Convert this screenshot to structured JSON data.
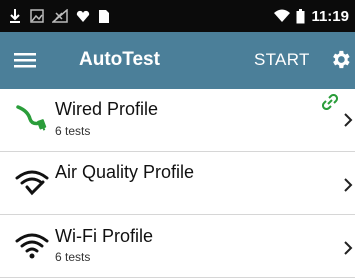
{
  "status_bar": {
    "time": "11:19",
    "left_icons": [
      "download-icon",
      "image-icon",
      "no-signal-icon",
      "heart-icon",
      "sim-card-icon"
    ],
    "right_icons": [
      "wifi-icon",
      "battery-icon"
    ]
  },
  "app_bar": {
    "title": "AutoTest",
    "start_label": "START",
    "color": "#4b7f99"
  },
  "profiles": [
    {
      "name": "Wired Profile",
      "subtitle": "6 tests",
      "icon": "ethernet-cable-icon",
      "accent": "#2a9d3a",
      "linked": true
    },
    {
      "name": "Air Quality Profile",
      "subtitle": "",
      "icon": "wifi-check-icon",
      "linked": false
    },
    {
      "name": "Wi-Fi Profile",
      "subtitle": "6 tests",
      "icon": "wifi-icon",
      "linked": false
    }
  ]
}
